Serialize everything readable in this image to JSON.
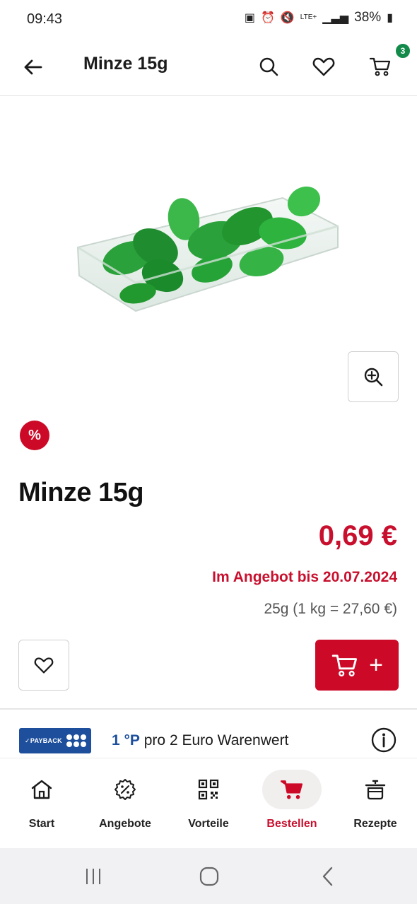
{
  "status_bar": {
    "time": "09:43",
    "network": "LTE+",
    "battery": "38%"
  },
  "header": {
    "title": "Minze 15g",
    "cart_count": "3"
  },
  "product": {
    "discount_symbol": "%",
    "name": "Minze 15g",
    "price": "0,69 €",
    "offer_until": "Im Angebot bis 20.07.2024",
    "unit_price": "25g (1 kg = 27,60 €)",
    "add_to_cart_plus": "+"
  },
  "payback": {
    "logo_text": "✓PAYBACK",
    "points": "1 °P",
    "rest": " pro 2 Euro Warenwert"
  },
  "bottom_nav": {
    "items": [
      {
        "label": "Start",
        "icon": "home-icon"
      },
      {
        "label": "Angebote",
        "icon": "discount-icon"
      },
      {
        "label": "Vorteile",
        "icon": "qr-code-icon"
      },
      {
        "label": "Bestellen",
        "icon": "cart-icon",
        "active": true
      },
      {
        "label": "Rezepte",
        "icon": "cooking-pot-icon"
      }
    ]
  },
  "colors": {
    "accent_red": "#cc0a27",
    "payback_blue": "#1d4f9c",
    "badge_green": "#138a4a"
  }
}
